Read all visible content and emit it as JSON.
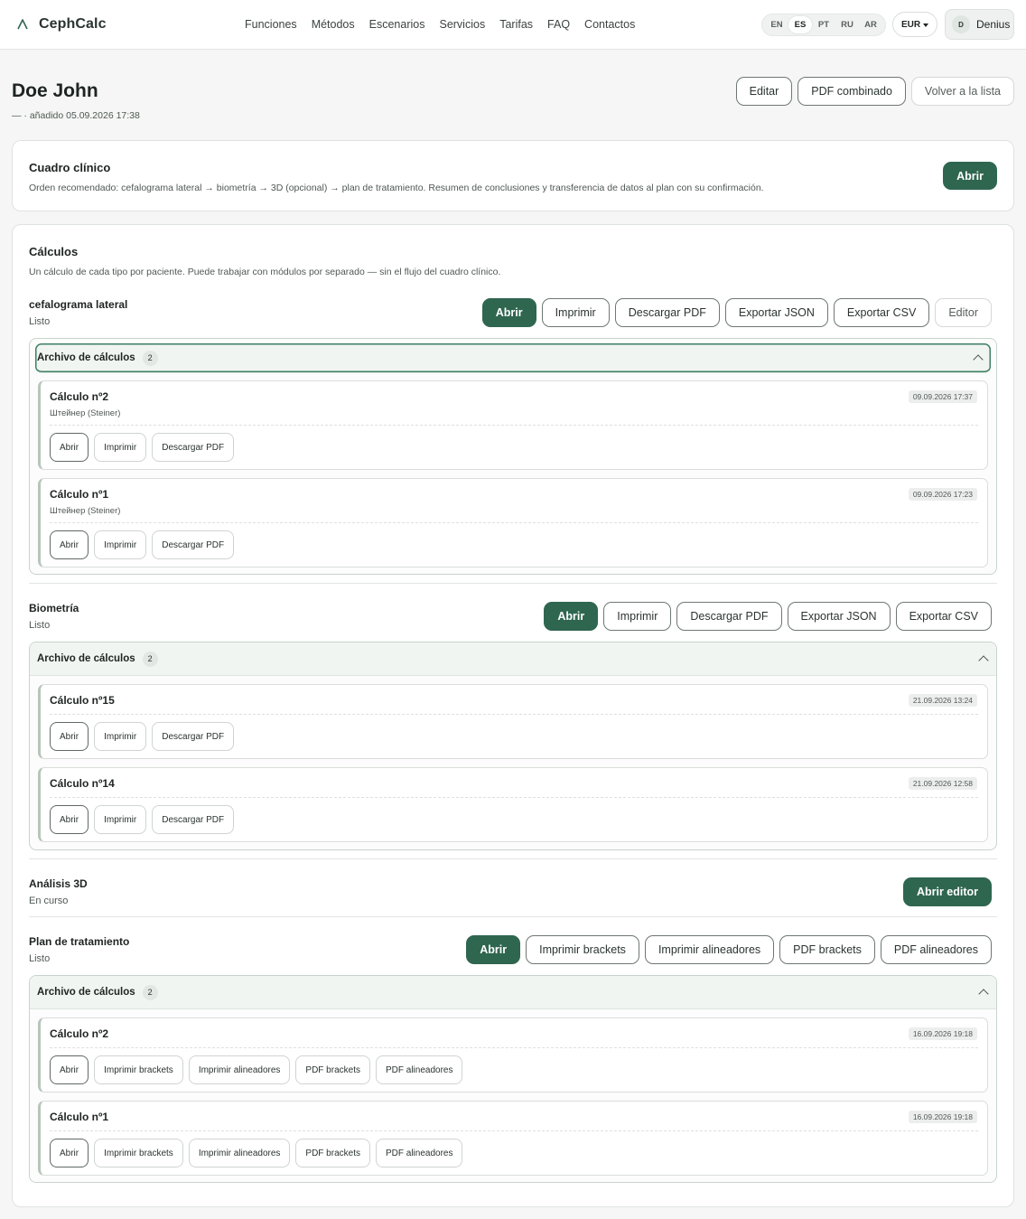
{
  "brand": {
    "name": "CephCalc"
  },
  "nav": [
    "Funciones",
    "Métodos",
    "Escenarios",
    "Servicios",
    "Tarifas",
    "FAQ",
    "Contactos"
  ],
  "languages": [
    {
      "code": "EN",
      "active": false
    },
    {
      "code": "ES",
      "active": true
    },
    {
      "code": "PT",
      "active": false
    },
    {
      "code": "RU",
      "active": false
    },
    {
      "code": "AR",
      "active": false
    }
  ],
  "currency": "EUR",
  "user": {
    "initial": "D",
    "name": "Denius"
  },
  "patient": {
    "name": "Doe John",
    "added": "— · añadido 05.09.2026 17:38"
  },
  "header_actions": {
    "edit": "Editar",
    "combined_pdf": "PDF combinado",
    "back": "Volver a la lista"
  },
  "clinical": {
    "title": "Cuadro clínico",
    "description": "Orden recomendado: cefalograma lateral → biometría → 3D (opcional) → plan de tratamiento. Resumen de conclusiones y transferencia de datos al plan con su confirmación.",
    "open": "Abrir"
  },
  "calculations": {
    "title": "Cálculos",
    "description": "Un cálculo de cada tipo por paciente. Puede trabajar con módulos por separado — sin el flujo del cuadro clínico."
  },
  "archive_label": "Archivo de cálculos",
  "modules": {
    "ceph": {
      "name": "cefalograma lateral",
      "status": "Listo",
      "actions": [
        "Abrir",
        "Imprimir",
        "Descargar PDF",
        "Exportar JSON",
        "Exportar CSV",
        "Editor"
      ],
      "archive_count": "2",
      "items": [
        {
          "title": "Cálculo nº2",
          "method": "Штейнер (Steiner)",
          "date": "09.09.2026 17:37",
          "actions": [
            "Abrir",
            "Imprimir",
            "Descargar PDF"
          ]
        },
        {
          "title": "Cálculo nº1",
          "method": "Штейнер (Steiner)",
          "date": "09.09.2026 17:23",
          "actions": [
            "Abrir",
            "Imprimir",
            "Descargar PDF"
          ]
        }
      ]
    },
    "bio": {
      "name": "Biometría",
      "status": "Listo",
      "actions": [
        "Abrir",
        "Imprimir",
        "Descargar PDF",
        "Exportar JSON",
        "Exportar CSV"
      ],
      "archive_count": "2",
      "items": [
        {
          "title": "Cálculo nº15",
          "date": "21.09.2026 13:24",
          "actions": [
            "Abrir",
            "Imprimir",
            "Descargar PDF"
          ]
        },
        {
          "title": "Cálculo nº14",
          "date": "21.09.2026 12:58",
          "actions": [
            "Abrir",
            "Imprimir",
            "Descargar PDF"
          ]
        }
      ]
    },
    "analysis3d": {
      "name": "Análisis 3D",
      "status": "En curso",
      "action": "Abrir editor"
    },
    "plan": {
      "name": "Plan de tratamiento",
      "status": "Listo",
      "actions": [
        "Abrir",
        "Imprimir brackets",
        "Imprimir alineadores",
        "PDF brackets",
        "PDF alineadores"
      ],
      "archive_count": "2",
      "items": [
        {
          "title": "Cálculo nº2",
          "date": "16.09.2026 19:18",
          "actions": [
            "Abrir",
            "Imprimir brackets",
            "Imprimir alineadores",
            "PDF brackets",
            "PDF alineadores"
          ]
        },
        {
          "title": "Cálculo nº1",
          "date": "16.09.2026 19:18",
          "actions": [
            "Abrir",
            "Imprimir brackets",
            "Imprimir alineadores",
            "PDF brackets",
            "PDF alineadores"
          ]
        }
      ]
    }
  }
}
